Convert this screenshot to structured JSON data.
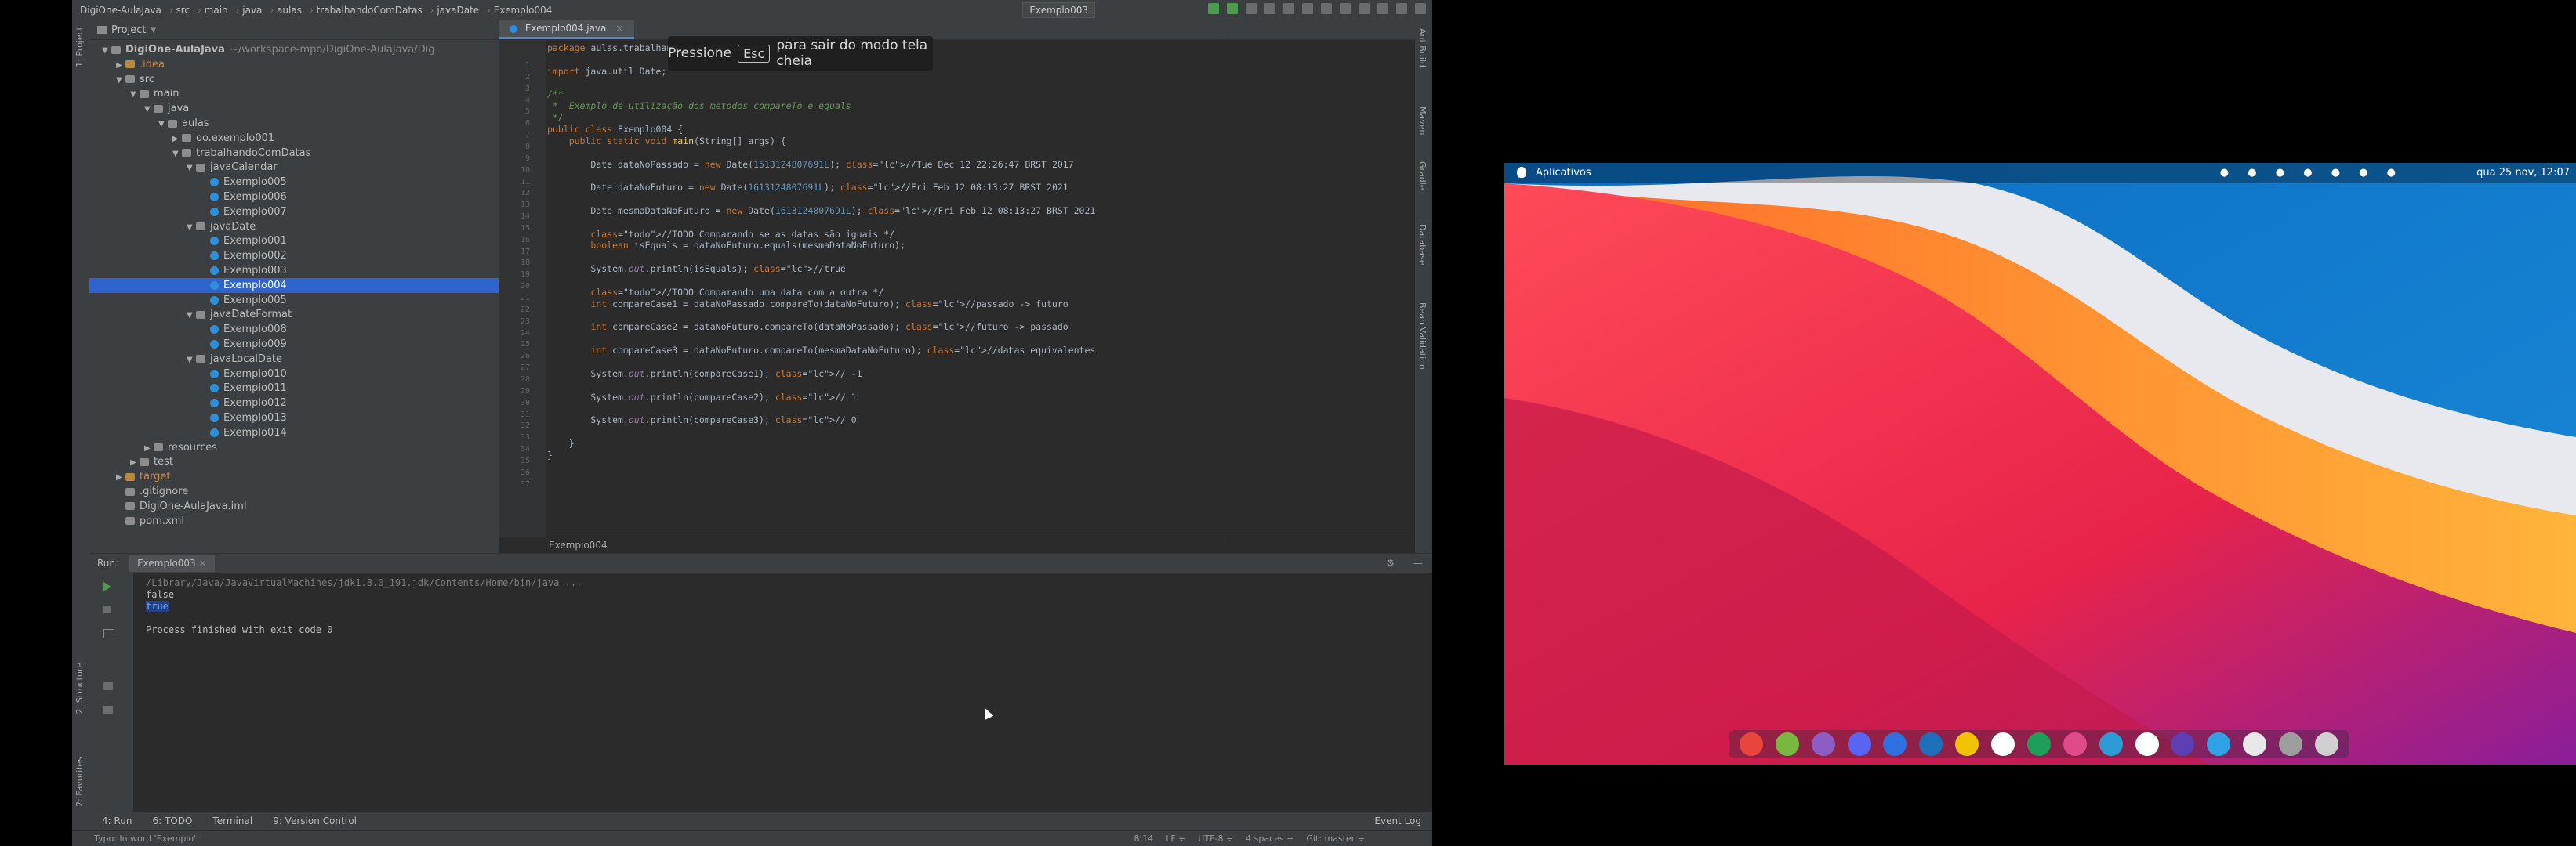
{
  "ide": {
    "breadcrumbs": [
      "DigiOne-AulaJava",
      "src",
      "main",
      "java",
      "aulas",
      "trabalhandoComDatas",
      "javaDate",
      "Exemplo004"
    ],
    "run_config": "Exemplo003",
    "project_panel_title": "Project",
    "tree": [
      {
        "label": "DigiOne-AulaJava",
        "extra": "~/workspace-mpo/DigiOne-AulaJava/Dig",
        "depth": 0,
        "kind": "folder-root",
        "open": true
      },
      {
        "label": ".idea",
        "depth": 1,
        "kind": "folder-excl",
        "open": false
      },
      {
        "label": "src",
        "depth": 1,
        "kind": "folder",
        "open": true
      },
      {
        "label": "main",
        "depth": 2,
        "kind": "folder",
        "open": true
      },
      {
        "label": "java",
        "depth": 3,
        "kind": "folder-src",
        "open": true
      },
      {
        "label": "aulas",
        "depth": 4,
        "kind": "package",
        "open": true
      },
      {
        "label": "oo.exemplo001",
        "depth": 5,
        "kind": "package",
        "open": false
      },
      {
        "label": "trabalhandoComDatas",
        "depth": 5,
        "kind": "package",
        "open": true
      },
      {
        "label": "javaCalendar",
        "depth": 6,
        "kind": "package",
        "open": true
      },
      {
        "label": "Exemplo005",
        "depth": 7,
        "kind": "class"
      },
      {
        "label": "Exemplo006",
        "depth": 7,
        "kind": "class"
      },
      {
        "label": "Exemplo007",
        "depth": 7,
        "kind": "class"
      },
      {
        "label": "javaDate",
        "depth": 6,
        "kind": "package",
        "open": true
      },
      {
        "label": "Exemplo001",
        "depth": 7,
        "kind": "class"
      },
      {
        "label": "Exemplo002",
        "depth": 7,
        "kind": "class"
      },
      {
        "label": "Exemplo003",
        "depth": 7,
        "kind": "class"
      },
      {
        "label": "Exemplo004",
        "depth": 7,
        "kind": "class",
        "selected": true
      },
      {
        "label": "Exemplo005",
        "depth": 7,
        "kind": "class"
      },
      {
        "label": "javaDateFormat",
        "depth": 6,
        "kind": "package",
        "open": true
      },
      {
        "label": "Exemplo008",
        "depth": 7,
        "kind": "class"
      },
      {
        "label": "Exemplo009",
        "depth": 7,
        "kind": "class"
      },
      {
        "label": "javaLocalDate",
        "depth": 6,
        "kind": "package",
        "open": true
      },
      {
        "label": "Exemplo010",
        "depth": 7,
        "kind": "class"
      },
      {
        "label": "Exemplo011",
        "depth": 7,
        "kind": "class"
      },
      {
        "label": "Exemplo012",
        "depth": 7,
        "kind": "class"
      },
      {
        "label": "Exemplo013",
        "depth": 7,
        "kind": "class"
      },
      {
        "label": "Exemplo014",
        "depth": 7,
        "kind": "class"
      },
      {
        "label": "resources",
        "depth": 3,
        "kind": "folder",
        "open": false
      },
      {
        "label": "test",
        "depth": 2,
        "kind": "folder",
        "open": false
      },
      {
        "label": "target",
        "depth": 1,
        "kind": "folder-excl",
        "open": false
      },
      {
        "label": ".gitignore",
        "depth": 1,
        "kind": "file"
      },
      {
        "label": "DigiOne-AulaJava.iml",
        "depth": 1,
        "kind": "file"
      },
      {
        "label": "pom.xml",
        "depth": 1,
        "kind": "file"
      }
    ],
    "editor_tab": "Exemplo004.java",
    "code": [
      {
        "n": "1",
        "text": "package aulas.trabalhandoComDatas.javaDate;"
      },
      {
        "n": "2",
        "text": ""
      },
      {
        "n": "3",
        "text": "import java.util.Date;"
      },
      {
        "n": "4",
        "text": ""
      },
      {
        "n": "5",
        "text": "/**"
      },
      {
        "n": "6",
        "text": " *  Exemplo de utilização dos metodos compareTo e equals"
      },
      {
        "n": "7",
        "text": " */"
      },
      {
        "n": "8",
        "text": "public class Exemplo004 {"
      },
      {
        "n": "9",
        "text": "    public static void main(String[] args) {"
      },
      {
        "n": "10",
        "text": ""
      },
      {
        "n": "11",
        "text": "        Date dataNoPassado = new Date(1513124807691L); //Tue Dec 12 22:26:47 BRST 2017"
      },
      {
        "n": "12",
        "text": ""
      },
      {
        "n": "13",
        "text": "        Date dataNoFuturo = new Date(1613124807691L); //Fri Feb 12 08:13:27 BRST 2021"
      },
      {
        "n": "14",
        "text": ""
      },
      {
        "n": "15",
        "text": "        Date mesmaDataNoFuturo = new Date(1613124807691L); //Fri Feb 12 08:13:27 BRST 2021"
      },
      {
        "n": "16",
        "text": ""
      },
      {
        "n": "17",
        "text": "        //TODO Comparando se as datas são iguais */"
      },
      {
        "n": "18",
        "text": "        boolean isEquals = dataNoFuturo.equals(mesmaDataNoFuturo);"
      },
      {
        "n": "19",
        "text": ""
      },
      {
        "n": "20",
        "text": "        System.out.println(isEquals); //true"
      },
      {
        "n": "21",
        "text": ""
      },
      {
        "n": "22",
        "text": "        //TODO Comparando uma data com a outra */"
      },
      {
        "n": "23",
        "text": "        int compareCase1 = dataNoPassado.compareTo(dataNoFuturo); //passado -> futuro"
      },
      {
        "n": "24",
        "text": ""
      },
      {
        "n": "25",
        "text": "        int compareCase2 = dataNoFuturo.compareTo(dataNoPassado); //futuro -> passado"
      },
      {
        "n": "26",
        "text": ""
      },
      {
        "n": "27",
        "text": "        int compareCase3 = dataNoFuturo.compareTo(mesmaDataNoFuturo); //datas equivalentes"
      },
      {
        "n": "28",
        "text": ""
      },
      {
        "n": "29",
        "text": "        System.out.println(compareCase1); // -1"
      },
      {
        "n": "30",
        "text": ""
      },
      {
        "n": "31",
        "text": "        System.out.println(compareCase2); // 1"
      },
      {
        "n": "32",
        "text": ""
      },
      {
        "n": "33",
        "text": "        System.out.println(compareCase3); // 0"
      },
      {
        "n": "34",
        "text": ""
      },
      {
        "n": "35",
        "text": "    }"
      },
      {
        "n": "36",
        "text": "}"
      },
      {
        "n": "37",
        "text": ""
      }
    ],
    "editor_footer": "Exemplo004",
    "fullscreen_toast": {
      "before": "Pressione",
      "key": "Esc",
      "after": "para sair do modo tela cheia"
    },
    "run_panel": {
      "label": "Run:",
      "tab": "Exemplo003",
      "output": [
        "/Library/Java/JavaVirtualMachines/jdk1.8.0_191.jdk/Contents/Home/bin/java ...",
        "false",
        "true",
        "",
        "Process finished with exit code 0"
      ]
    },
    "toolwindows": [
      "4: Run",
      "6: TODO",
      "Terminal",
      "9: Version Control"
    ],
    "event_log": "Event Log",
    "status_left": "Typo: In word 'Exemplo'",
    "status_right": [
      "8:14",
      "LF ÷",
      "UTF-8 ÷",
      "4 spaces ÷",
      "Git: master ÷"
    ],
    "left_tabs": [
      "1: Project",
      "2: Structure",
      "2: Favorites"
    ],
    "right_tabs": [
      "Ant Build",
      "Maven",
      "Gradle",
      "Database",
      "Bean Validation"
    ]
  },
  "desktop": {
    "menu": "Aplicativos",
    "clock": "qua 25 nov, 12:07",
    "dock_colors": [
      "#e8453c",
      "#79b83f",
      "#8d5cc4",
      "#5865f2",
      "#2f6fdf",
      "#1f6fb8",
      "#f2c200",
      "#ffffff",
      "#1d9f5a",
      "#e04a89",
      "#2d9bd6",
      "#ffffff",
      "#5b3fb3",
      "#2fa2e6",
      "#e8e8e8",
      "#9e9e9e",
      "#d0d0d0"
    ]
  }
}
